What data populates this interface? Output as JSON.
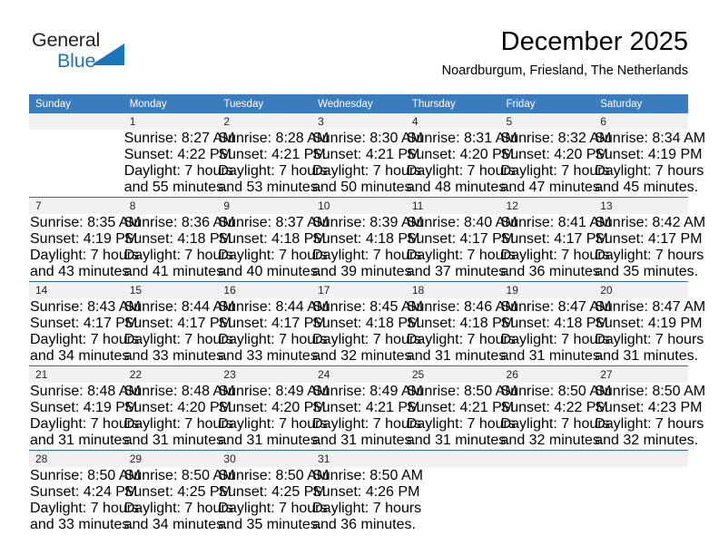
{
  "brand": {
    "name_top": "General",
    "name_bottom": "Blue",
    "logo_color": "#1b75bb"
  },
  "header": {
    "title": "December 2025",
    "subtitle": "Noardburgum, Friesland, The Netherlands"
  },
  "theme": {
    "header_bg": "#3a7cbe",
    "row_divider": "#2e6da8",
    "daynum_bg": "#f1f1f1",
    "text": "#231f20"
  },
  "weekdays": [
    "Sunday",
    "Monday",
    "Tuesday",
    "Wednesday",
    "Thursday",
    "Friday",
    "Saturday"
  ],
  "weeks": [
    [
      {
        "day": "",
        "sunrise": "",
        "sunset": "",
        "daylight1": "",
        "daylight2": ""
      },
      {
        "day": "1",
        "sunrise": "Sunrise: 8:27 AM",
        "sunset": "Sunset: 4:22 PM",
        "daylight1": "Daylight: 7 hours",
        "daylight2": "and 55 minutes."
      },
      {
        "day": "2",
        "sunrise": "Sunrise: 8:28 AM",
        "sunset": "Sunset: 4:21 PM",
        "daylight1": "Daylight: 7 hours",
        "daylight2": "and 53 minutes."
      },
      {
        "day": "3",
        "sunrise": "Sunrise: 8:30 AM",
        "sunset": "Sunset: 4:21 PM",
        "daylight1": "Daylight: 7 hours",
        "daylight2": "and 50 minutes."
      },
      {
        "day": "4",
        "sunrise": "Sunrise: 8:31 AM",
        "sunset": "Sunset: 4:20 PM",
        "daylight1": "Daylight: 7 hours",
        "daylight2": "and 48 minutes."
      },
      {
        "day": "5",
        "sunrise": "Sunrise: 8:32 AM",
        "sunset": "Sunset: 4:20 PM",
        "daylight1": "Daylight: 7 hours",
        "daylight2": "and 47 minutes."
      },
      {
        "day": "6",
        "sunrise": "Sunrise: 8:34 AM",
        "sunset": "Sunset: 4:19 PM",
        "daylight1": "Daylight: 7 hours",
        "daylight2": "and 45 minutes."
      }
    ],
    [
      {
        "day": "7",
        "sunrise": "Sunrise: 8:35 AM",
        "sunset": "Sunset: 4:19 PM",
        "daylight1": "Daylight: 7 hours",
        "daylight2": "and 43 minutes."
      },
      {
        "day": "8",
        "sunrise": "Sunrise: 8:36 AM",
        "sunset": "Sunset: 4:18 PM",
        "daylight1": "Daylight: 7 hours",
        "daylight2": "and 41 minutes."
      },
      {
        "day": "9",
        "sunrise": "Sunrise: 8:37 AM",
        "sunset": "Sunset: 4:18 PM",
        "daylight1": "Daylight: 7 hours",
        "daylight2": "and 40 minutes."
      },
      {
        "day": "10",
        "sunrise": "Sunrise: 8:39 AM",
        "sunset": "Sunset: 4:18 PM",
        "daylight1": "Daylight: 7 hours",
        "daylight2": "and 39 minutes."
      },
      {
        "day": "11",
        "sunrise": "Sunrise: 8:40 AM",
        "sunset": "Sunset: 4:17 PM",
        "daylight1": "Daylight: 7 hours",
        "daylight2": "and 37 minutes."
      },
      {
        "day": "12",
        "sunrise": "Sunrise: 8:41 AM",
        "sunset": "Sunset: 4:17 PM",
        "daylight1": "Daylight: 7 hours",
        "daylight2": "and 36 minutes."
      },
      {
        "day": "13",
        "sunrise": "Sunrise: 8:42 AM",
        "sunset": "Sunset: 4:17 PM",
        "daylight1": "Daylight: 7 hours",
        "daylight2": "and 35 minutes."
      }
    ],
    [
      {
        "day": "14",
        "sunrise": "Sunrise: 8:43 AM",
        "sunset": "Sunset: 4:17 PM",
        "daylight1": "Daylight: 7 hours",
        "daylight2": "and 34 minutes."
      },
      {
        "day": "15",
        "sunrise": "Sunrise: 8:44 AM",
        "sunset": "Sunset: 4:17 PM",
        "daylight1": "Daylight: 7 hours",
        "daylight2": "and 33 minutes."
      },
      {
        "day": "16",
        "sunrise": "Sunrise: 8:44 AM",
        "sunset": "Sunset: 4:17 PM",
        "daylight1": "Daylight: 7 hours",
        "daylight2": "and 33 minutes."
      },
      {
        "day": "17",
        "sunrise": "Sunrise: 8:45 AM",
        "sunset": "Sunset: 4:18 PM",
        "daylight1": "Daylight: 7 hours",
        "daylight2": "and 32 minutes."
      },
      {
        "day": "18",
        "sunrise": "Sunrise: 8:46 AM",
        "sunset": "Sunset: 4:18 PM",
        "daylight1": "Daylight: 7 hours",
        "daylight2": "and 31 minutes."
      },
      {
        "day": "19",
        "sunrise": "Sunrise: 8:47 AM",
        "sunset": "Sunset: 4:18 PM",
        "daylight1": "Daylight: 7 hours",
        "daylight2": "and 31 minutes."
      },
      {
        "day": "20",
        "sunrise": "Sunrise: 8:47 AM",
        "sunset": "Sunset: 4:19 PM",
        "daylight1": "Daylight: 7 hours",
        "daylight2": "and 31 minutes."
      }
    ],
    [
      {
        "day": "21",
        "sunrise": "Sunrise: 8:48 AM",
        "sunset": "Sunset: 4:19 PM",
        "daylight1": "Daylight: 7 hours",
        "daylight2": "and 31 minutes."
      },
      {
        "day": "22",
        "sunrise": "Sunrise: 8:48 AM",
        "sunset": "Sunset: 4:20 PM",
        "daylight1": "Daylight: 7 hours",
        "daylight2": "and 31 minutes."
      },
      {
        "day": "23",
        "sunrise": "Sunrise: 8:49 AM",
        "sunset": "Sunset: 4:20 PM",
        "daylight1": "Daylight: 7 hours",
        "daylight2": "and 31 minutes."
      },
      {
        "day": "24",
        "sunrise": "Sunrise: 8:49 AM",
        "sunset": "Sunset: 4:21 PM",
        "daylight1": "Daylight: 7 hours",
        "daylight2": "and 31 minutes."
      },
      {
        "day": "25",
        "sunrise": "Sunrise: 8:50 AM",
        "sunset": "Sunset: 4:21 PM",
        "daylight1": "Daylight: 7 hours",
        "daylight2": "and 31 minutes."
      },
      {
        "day": "26",
        "sunrise": "Sunrise: 8:50 AM",
        "sunset": "Sunset: 4:22 PM",
        "daylight1": "Daylight: 7 hours",
        "daylight2": "and 32 minutes."
      },
      {
        "day": "27",
        "sunrise": "Sunrise: 8:50 AM",
        "sunset": "Sunset: 4:23 PM",
        "daylight1": "Daylight: 7 hours",
        "daylight2": "and 32 minutes."
      }
    ],
    [
      {
        "day": "28",
        "sunrise": "Sunrise: 8:50 AM",
        "sunset": "Sunset: 4:24 PM",
        "daylight1": "Daylight: 7 hours",
        "daylight2": "and 33 minutes."
      },
      {
        "day": "29",
        "sunrise": "Sunrise: 8:50 AM",
        "sunset": "Sunset: 4:25 PM",
        "daylight1": "Daylight: 7 hours",
        "daylight2": "and 34 minutes."
      },
      {
        "day": "30",
        "sunrise": "Sunrise: 8:50 AM",
        "sunset": "Sunset: 4:25 PM",
        "daylight1": "Daylight: 7 hours",
        "daylight2": "and 35 minutes."
      },
      {
        "day": "31",
        "sunrise": "Sunrise: 8:50 AM",
        "sunset": "Sunset: 4:26 PM",
        "daylight1": "Daylight: 7 hours",
        "daylight2": "and 36 minutes."
      },
      {
        "day": "",
        "sunrise": "",
        "sunset": "",
        "daylight1": "",
        "daylight2": ""
      },
      {
        "day": "",
        "sunrise": "",
        "sunset": "",
        "daylight1": "",
        "daylight2": ""
      },
      {
        "day": "",
        "sunrise": "",
        "sunset": "",
        "daylight1": "",
        "daylight2": ""
      }
    ]
  ]
}
